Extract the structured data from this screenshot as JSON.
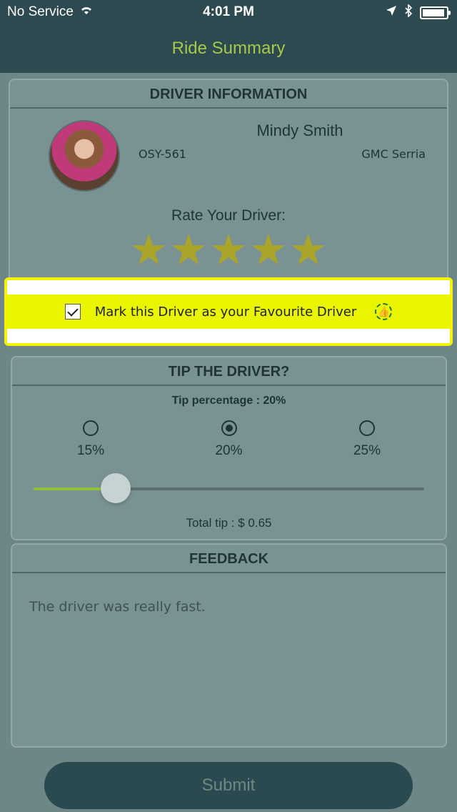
{
  "status_bar": {
    "carrier": "No Service",
    "wifi_icon": "wifi-icon",
    "time": "4:01 PM",
    "location_icon": "location-arrow-icon",
    "bluetooth_icon": "bluetooth-icon",
    "battery_icon": "battery-icon"
  },
  "navbar": {
    "title": "Ride Summary",
    "title_color": "#a8c84b"
  },
  "driver_section": {
    "heading": "DRIVER INFORMATION",
    "name": "Mindy Smith",
    "plate": "OSY-561",
    "car_model": "GMC Serria",
    "rate_label": "Rate Your Driver:",
    "rating": 5,
    "max_rating": 5,
    "stars": [
      "★",
      "★",
      "★",
      "★",
      "★"
    ],
    "favourite_label": "Mark this Driver as your Favourite Driver",
    "favourite_checked": true,
    "favourite_icon": "thumbs-up-icon",
    "favourite_icon_glyph": "👍"
  },
  "tip_section": {
    "heading": "TIP THE DRIVER?",
    "tip_percentage_text": "Tip percentage : 20%",
    "options": [
      {
        "label": "15%",
        "selected": false
      },
      {
        "label": "20%",
        "selected": true
      },
      {
        "label": "25%",
        "selected": false
      }
    ],
    "slider_value": 0.21,
    "total_tip_text": "Total tip : $ 0.65"
  },
  "feedback_section": {
    "heading": "FEEDBACK",
    "text": "The driver was really fast."
  },
  "submit_label": "Submit",
  "colors": {
    "accent": "#a8c84b",
    "nav_bg": "#2c4a50",
    "highlight": "#eaf500",
    "star": "#a9a52a"
  }
}
